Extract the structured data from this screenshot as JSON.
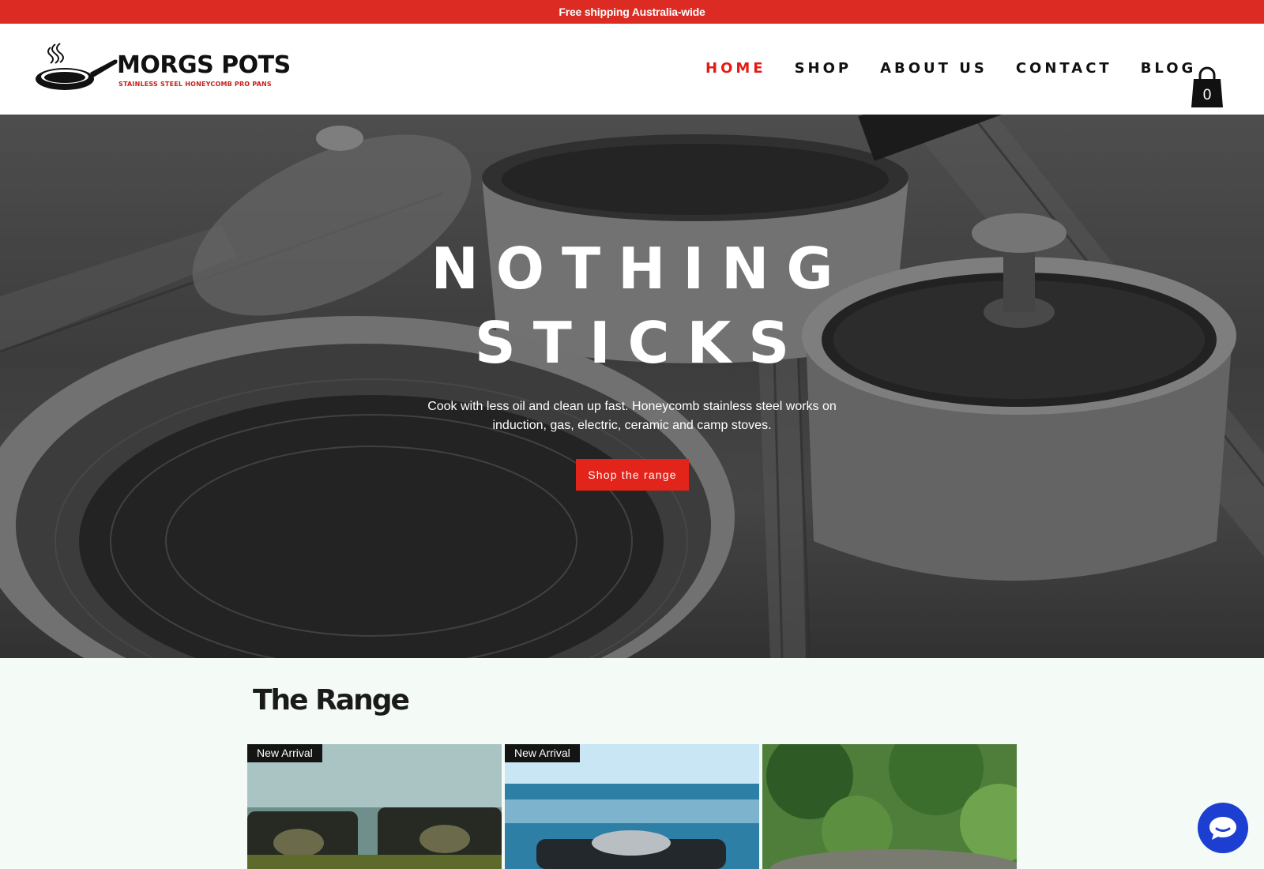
{
  "announcement": "Free shipping Australia-wide",
  "brand": {
    "name": "MORGS POTS",
    "tagline": "STAINLESS STEEL HONEYCOMB PRO PANS"
  },
  "nav": [
    {
      "label": "HOME",
      "active": true
    },
    {
      "label": "SHOP",
      "active": false
    },
    {
      "label": "ABOUT US",
      "active": false
    },
    {
      "label": "CONTACT",
      "active": false
    },
    {
      "label": "BLOG",
      "active": false
    }
  ],
  "cart": {
    "count": "0",
    "icon": "shopping-bag-icon"
  },
  "hero": {
    "title_line1": "NOTHING",
    "title_line2": "STICKS",
    "text": "Cook with less oil and clean up fast. Honeycomb stainless steel works on induction, gas, electric, ceramic and camp stoves.",
    "button": "Shop the range"
  },
  "range": {
    "title": "The Range",
    "products": [
      {
        "badge": "New Arrival"
      },
      {
        "badge": "New Arrival"
      },
      {
        "badge": ""
      }
    ]
  },
  "chat": {
    "icon": "chat-icon"
  },
  "colors": {
    "accent": "#db2b22",
    "nav_active": "#e21c14",
    "chat": "#1d3fd1",
    "section_bg": "#f4fbf6"
  }
}
